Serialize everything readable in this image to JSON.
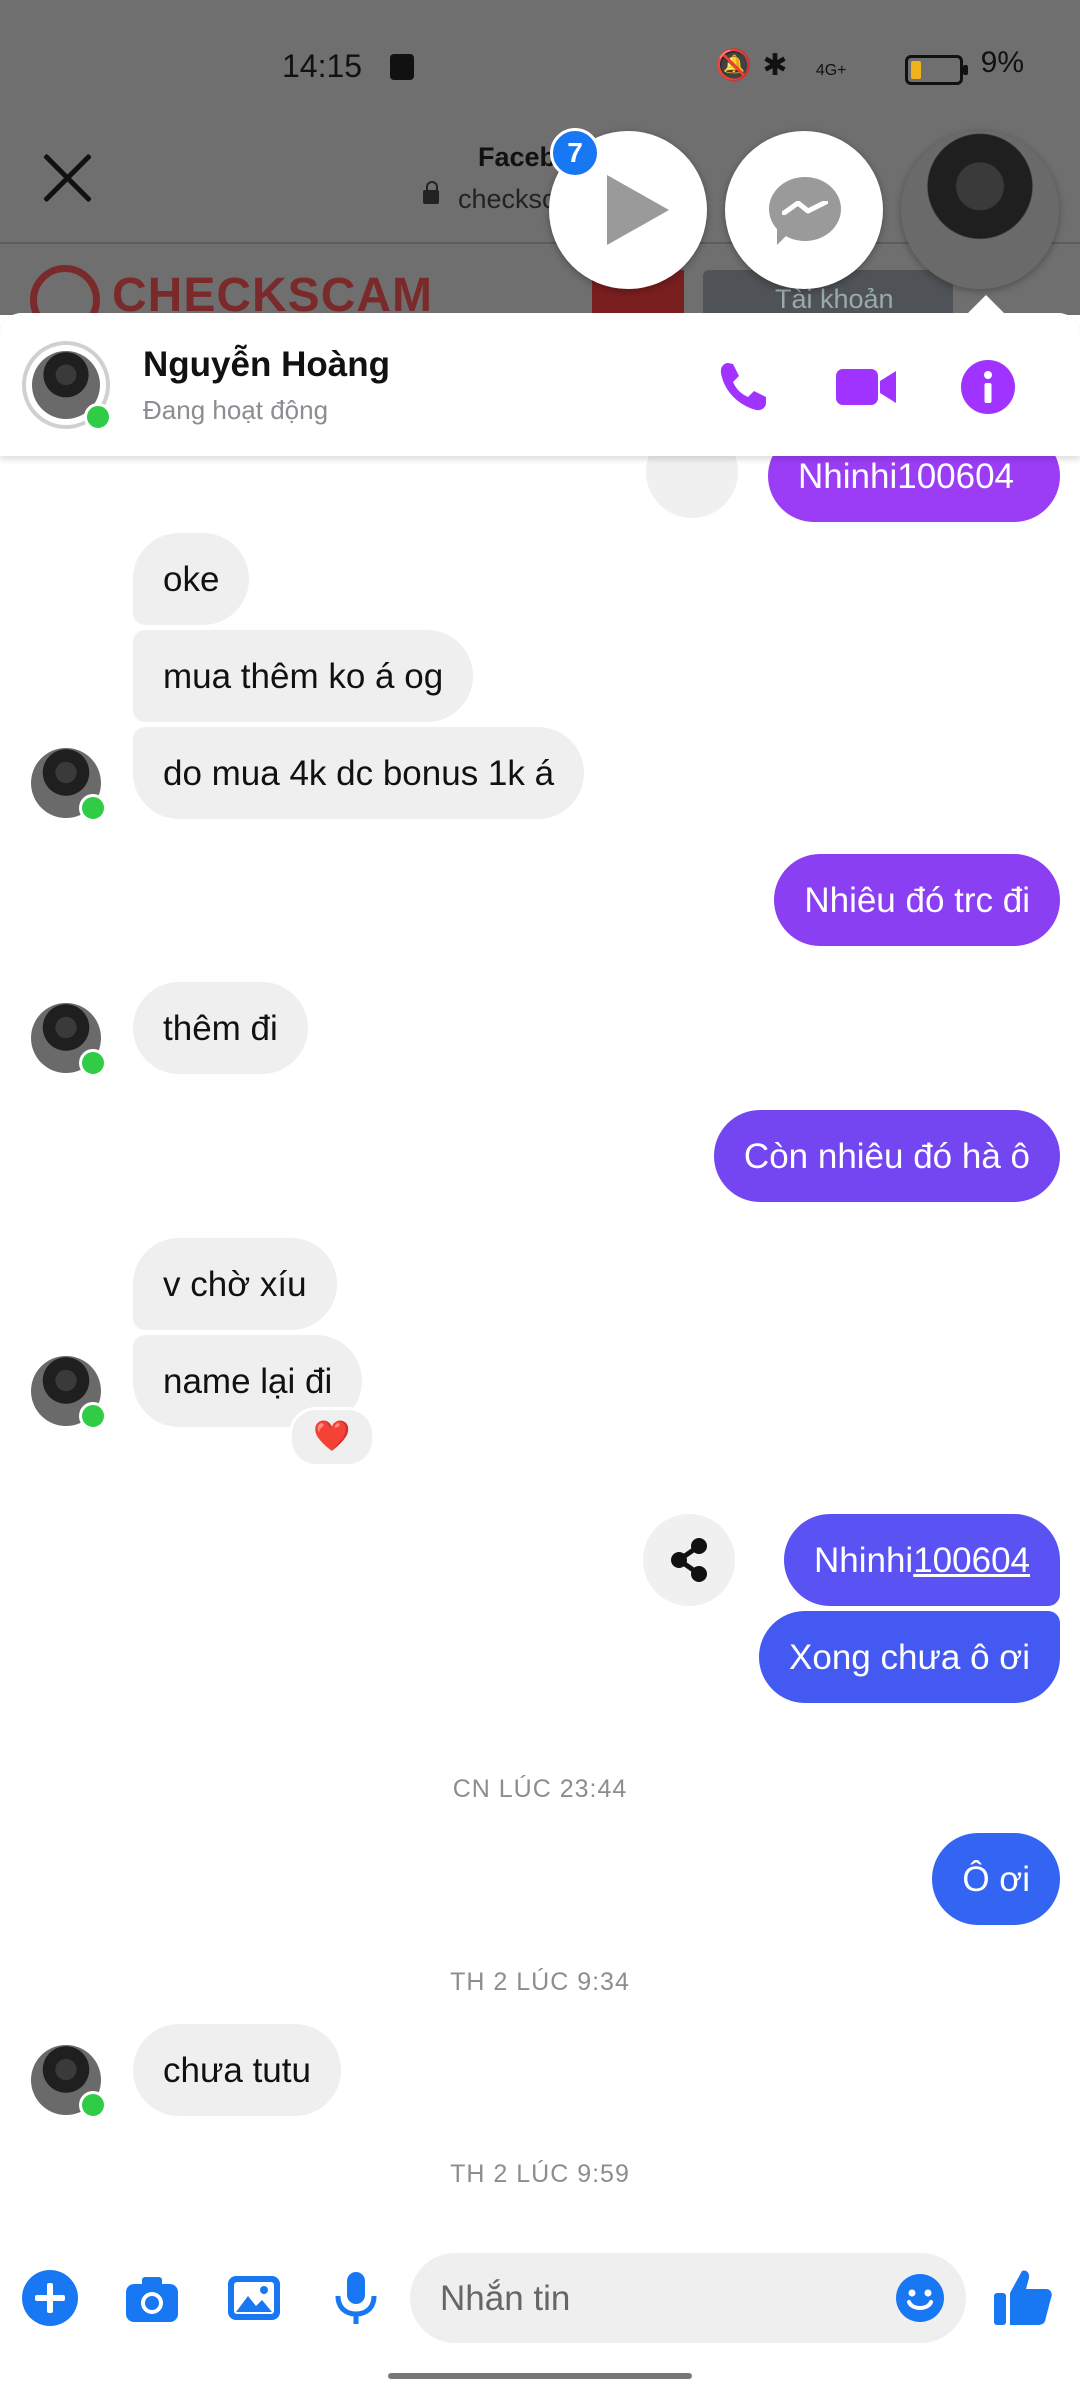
{
  "status_bar": {
    "time": "14:15",
    "battery": "9%",
    "network": "4G+"
  },
  "browser": {
    "title": "Faceb",
    "url": "checksc",
    "site_logo": "CHECKSCAM",
    "account_button": "Tài khoản"
  },
  "chat_heads": {
    "badge_count": "7",
    "icons": [
      "play-icon",
      "messenger-icon",
      "contact-avatar"
    ]
  },
  "header": {
    "name": "Nguyễn Hoàng",
    "status": "Đang hoạt động",
    "actions": [
      "phone-icon",
      "video-icon",
      "info-icon"
    ],
    "accent_color": "#a033ff"
  },
  "messages": [
    {
      "side": "out",
      "text": "Nhinhi100604",
      "partial": true
    },
    {
      "side": "in",
      "text": "oke"
    },
    {
      "side": "in",
      "text": "mua thêm ko á og"
    },
    {
      "side": "in",
      "text": "do mua 4k dc bonus 1k á"
    },
    {
      "side": "out",
      "text": "Nhiêu đó trc đi"
    },
    {
      "side": "in",
      "text": "thêm đi"
    },
    {
      "side": "out",
      "text": "Còn nhiêu đó hà ô"
    },
    {
      "side": "in",
      "text": "v chờ xíu"
    },
    {
      "side": "in",
      "text": "name lại đi",
      "reaction": "❤️"
    },
    {
      "side": "out",
      "text_prefix": "Nhinhi",
      "text_link": "100604"
    },
    {
      "side": "out",
      "text": "Xong chưa ô ơi"
    },
    {
      "side": "out",
      "text": "Ô ơi"
    },
    {
      "side": "in",
      "text": "chưa tutu"
    }
  ],
  "timestamps": [
    "CN LÚC 23:44",
    "TH 2 LÚC 9:34",
    "TH 2 LÚC 9:59"
  ],
  "composer": {
    "placeholder": "Nhắn tin",
    "buttons": [
      "plus-icon",
      "camera-icon",
      "gallery-icon",
      "mic-icon",
      "emoji-icon",
      "like-icon"
    ]
  }
}
